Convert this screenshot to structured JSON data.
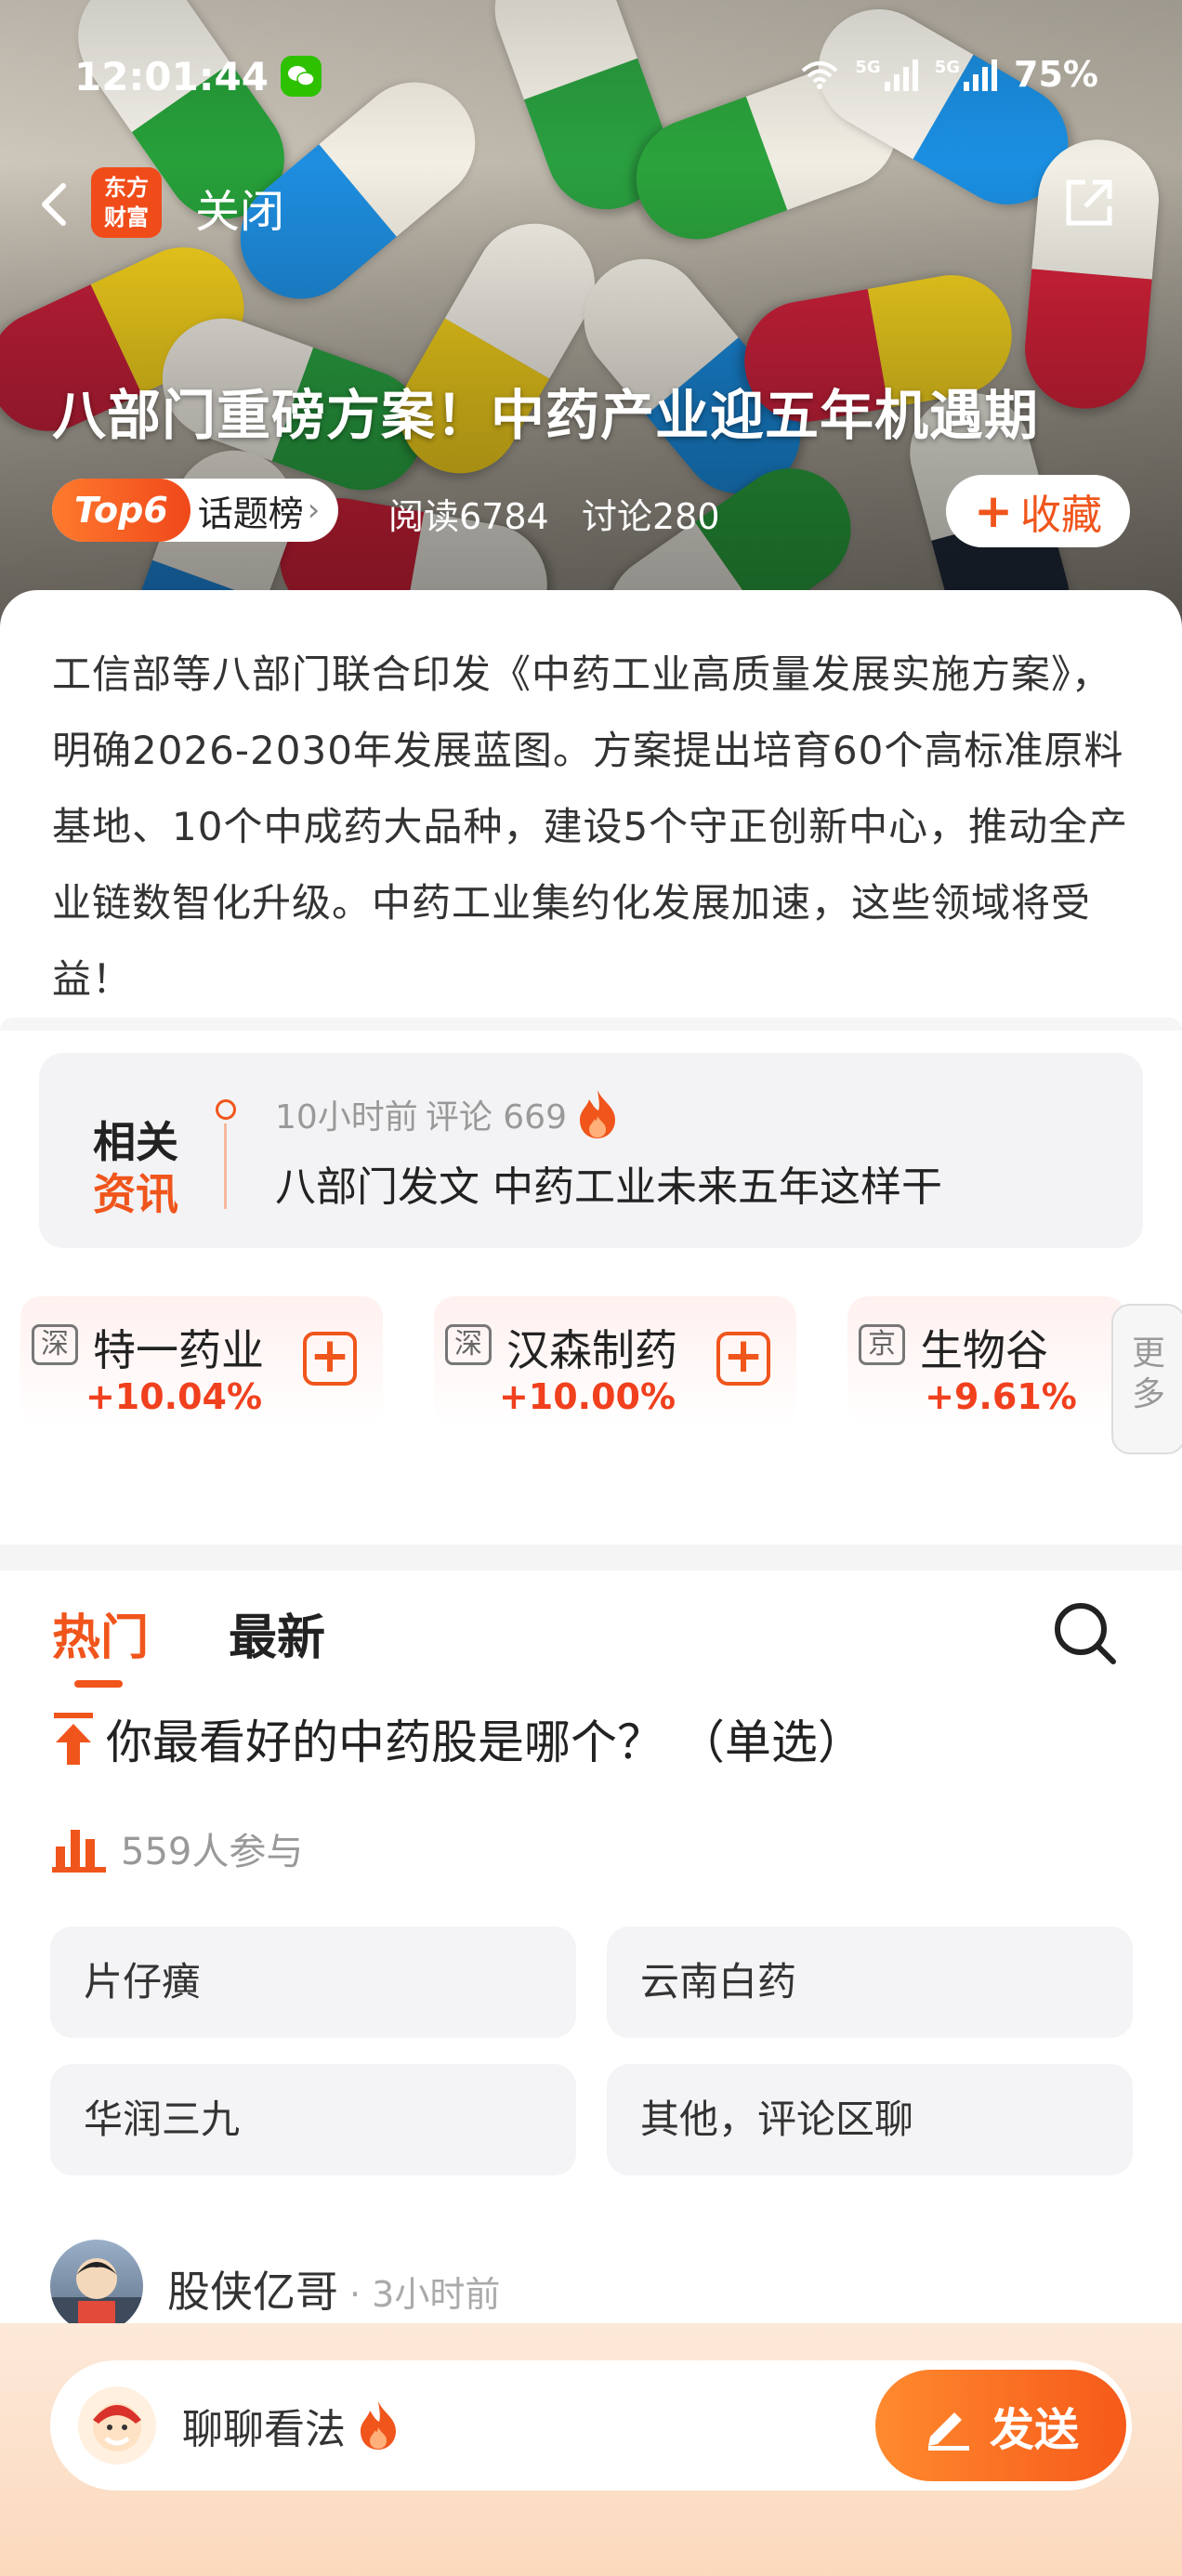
{
  "status_bar": {
    "time": "12:01:44",
    "net1": "5G",
    "net2": "5G",
    "battery": "75%"
  },
  "nav": {
    "brand_line1": "东方",
    "brand_line2": "财富",
    "close_label": "关闭"
  },
  "hero": {
    "title": "八部门重磅方案！中药产业迎五年机遇期",
    "rank_tag": "Top6",
    "rank_label": "话题榜",
    "read_count": "阅读6784",
    "discuss_count": "讨论280",
    "favorite_label": "收藏"
  },
  "summary": "工信部等八部门联合印发《中药工业高质量发展实施方案》，明确2026-2030年发展蓝图。方案提出培育60个高标准原料基地、10个中成药大品种，建设5个守正创新中心，推动全产业链数智化升级。中药工业集约化发展加速，这些领域将受益！",
  "related_news": {
    "tag_line1": "相关",
    "tag_line2": "资讯",
    "time": "10小时前",
    "comments": "评论 669",
    "headline": "八部门发文 中药工业未来五年这样干"
  },
  "stocks": [
    {
      "exchange": "深",
      "name": "特一药业",
      "change": "+10.04%"
    },
    {
      "exchange": "深",
      "name": "汉森制药",
      "change": "+10.00%"
    },
    {
      "exchange": "京",
      "name": "生物谷",
      "change": "+9.61%"
    }
  ],
  "more_label_1": "更",
  "more_label_2": "多",
  "tabs": {
    "hot": "热门",
    "latest": "最新"
  },
  "poll": {
    "question": "你最看好的中药股是哪个？ （单选）",
    "participants": "559人参与",
    "options": [
      "片仔癀",
      "云南白药",
      "华润三九",
      "其他，评论区聊"
    ]
  },
  "comment": {
    "user": "股侠亿哥",
    "time": "· 3小时前"
  },
  "bottom": {
    "placeholder": "聊聊看法",
    "send_label": "发送"
  },
  "colors": {
    "accent": "#f0551c",
    "rise": "#f0401e"
  }
}
